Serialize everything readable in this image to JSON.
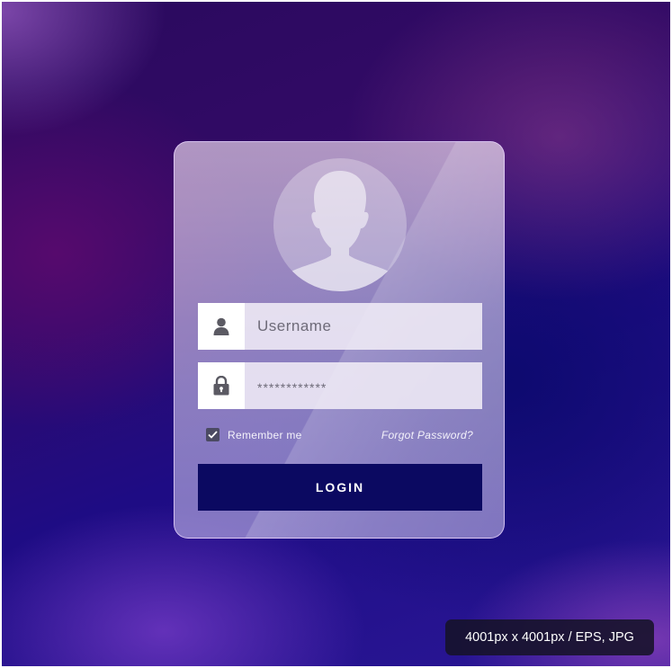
{
  "login_form": {
    "username_placeholder": "Username",
    "password_value": "************",
    "remember_label": "Remember me",
    "remember_checked": true,
    "forgot_label": "Forgot Password?",
    "login_label": "LOGIN"
  },
  "icons": {
    "avatar": "user-silhouette-icon",
    "username": "user-icon",
    "password": "lock-icon",
    "checkbox": "checkmark-icon"
  },
  "badge": {
    "size_text": "4001px x 4001px / EPS, JPG"
  },
  "colors": {
    "login_button": "#0b0961",
    "checkbox": "#4b4a63",
    "badge_bg": "#16122a"
  }
}
